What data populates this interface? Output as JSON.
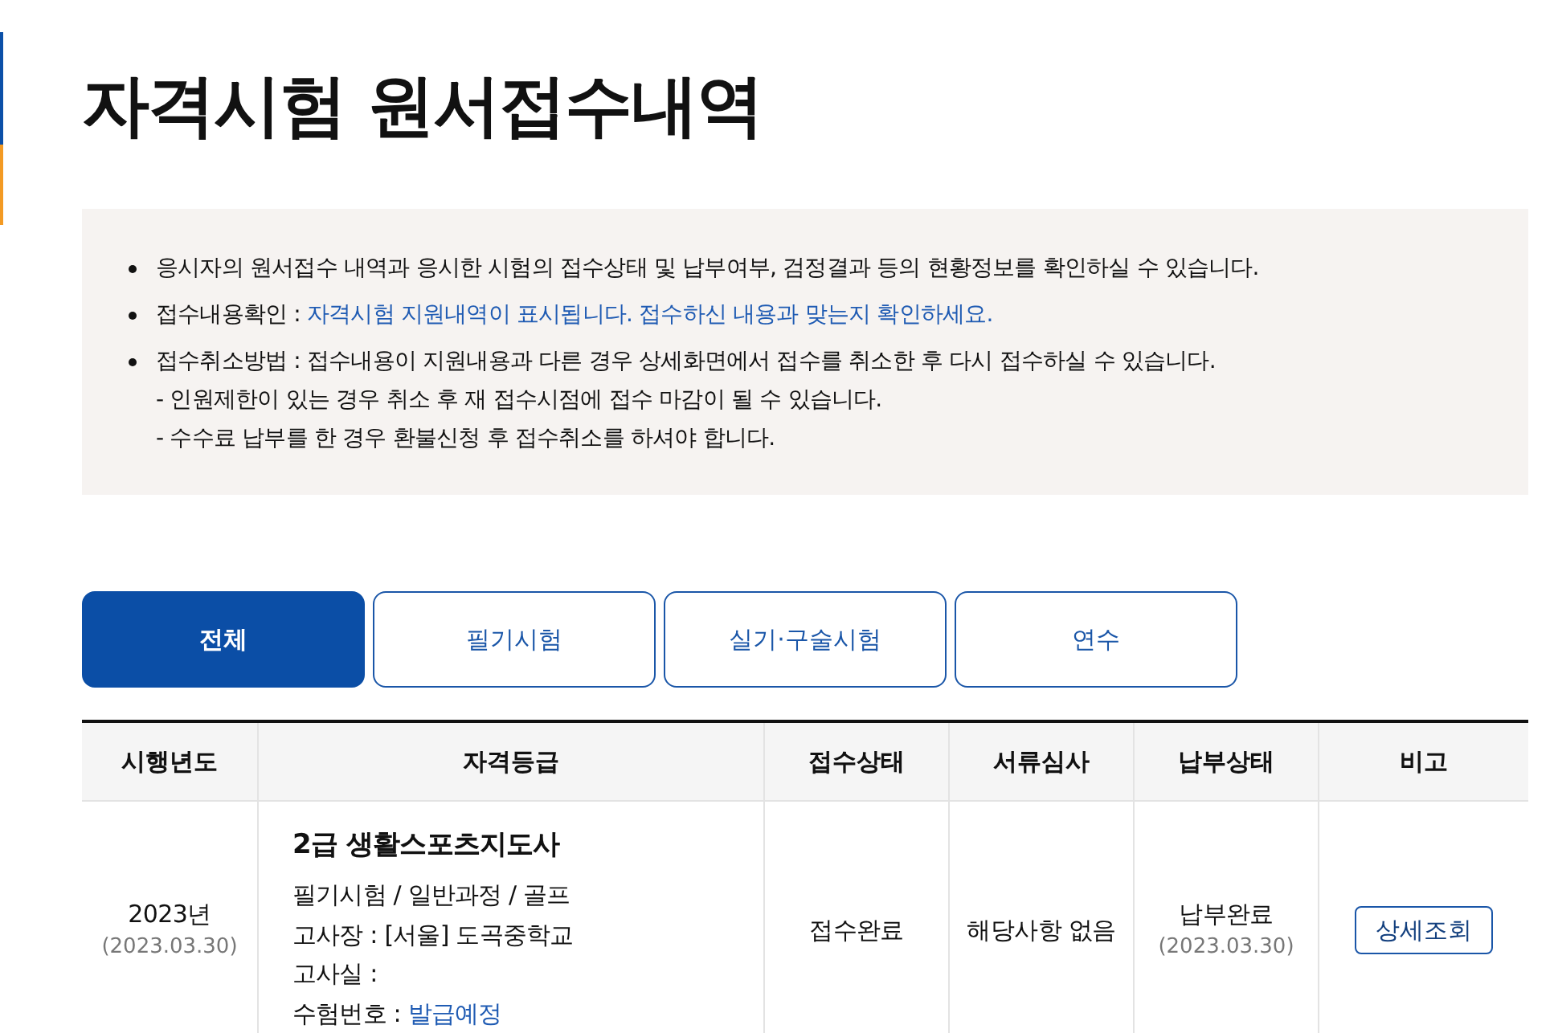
{
  "page_title": "자격시험 원서접수내역",
  "notice": {
    "items": [
      {
        "text": "응시자의 원서접수 내역과 응시한 시험의 접수상태 및 납부여부, 검정결과 등의 현황정보를 확인하실 수 있습니다.",
        "highlighted": false
      },
      {
        "label": "접수내용확인 :",
        "text": "자격시험 지원내역이 표시됩니다. 접수하신 내용과 맞는지 확인하세요.",
        "highlighted": true
      },
      {
        "label": "접수취소방법 :",
        "text": "접수내용이 지원내용과 다른 경우 상세화면에서 접수를 취소한 후 다시 접수하실 수 있습니다.",
        "highlighted": false,
        "notes": [
          "- 인원제한이 있는 경우 취소 후 재 접수시점에 접수 마감이 될 수 있습니다.",
          "- 수수료 납부를 한 경우 환불신청 후 접수취소를 하셔야 합니다."
        ]
      }
    ]
  },
  "tabs": [
    {
      "label": "전체",
      "selected": true
    },
    {
      "label": "필기시험",
      "selected": false
    },
    {
      "label": "실기·구술시험",
      "selected": false
    },
    {
      "label": "연수",
      "selected": false
    }
  ],
  "table": {
    "columns": [
      "시행년도",
      "자격등급",
      "접수상태",
      "서류심사",
      "납부상태",
      "비고"
    ],
    "rows": [
      {
        "year": "2023년",
        "year_date": "(2023.03.30)",
        "grade": {
          "title": "2급 생활스포츠지도사",
          "exam_type": "필기시험 / 일반과정 / 골프",
          "venue": "고사장 : [서울] 도곡중학교",
          "room": "고사실 :",
          "exam_number_label": "수험번호 :",
          "exam_number_value": "발급예정"
        },
        "receipt_status": "접수완료",
        "document_review": "해당사항 없음",
        "payment_status": "납부완료",
        "payment_date": "(2023.03.30)",
        "action": "상세조회"
      }
    ]
  }
}
